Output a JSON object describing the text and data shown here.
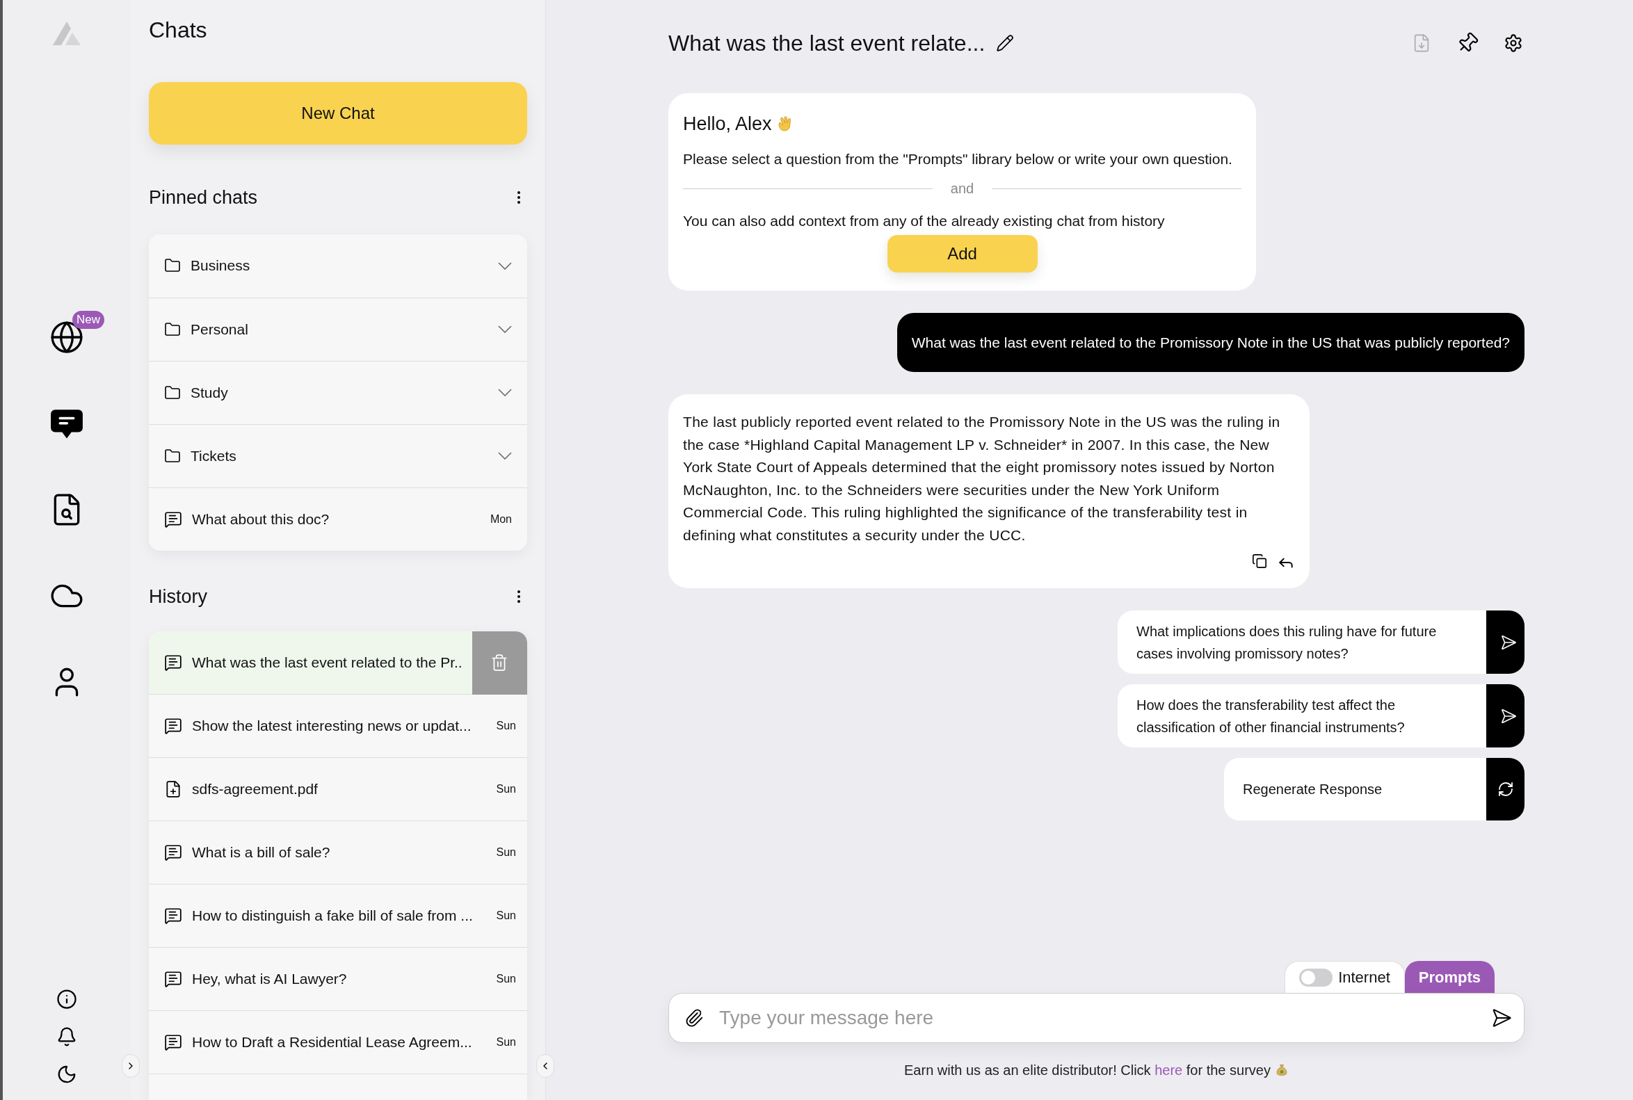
{
  "nav": {
    "items": [
      {
        "kind": "globe",
        "badge": "New",
        "selected": false
      },
      {
        "kind": "chat",
        "selected": true
      },
      {
        "kind": "doc",
        "selected": false
      },
      {
        "kind": "cloud",
        "selected": false
      },
      {
        "kind": "user",
        "selected": false
      }
    ]
  },
  "sidebar": {
    "title": "Chats",
    "new_chat": "New Chat",
    "pinned": {
      "title": "Pinned chats",
      "items": [
        {
          "kind": "folder",
          "label": "Business"
        },
        {
          "kind": "folder",
          "label": "Personal"
        },
        {
          "kind": "folder",
          "label": "Study"
        },
        {
          "kind": "folder",
          "label": "Tickets"
        },
        {
          "kind": "chat",
          "label": "What about this doc?",
          "date": "Mon"
        }
      ]
    },
    "history": {
      "title": "History",
      "items": [
        {
          "kind": "chat",
          "label": "What was the last event related to the Pr..",
          "selected": true
        },
        {
          "kind": "chat",
          "label": "Show the latest interesting news or updat...",
          "date": "Sun",
          "selected": false
        },
        {
          "kind": "file",
          "label": "sdfs-agreement.pdf",
          "date": "Sun",
          "selected": false
        },
        {
          "kind": "chat",
          "label": "What is a bill of sale?",
          "date": "Sun",
          "selected": false
        },
        {
          "kind": "chat",
          "label": "How to distinguish a fake bill of sale from ...",
          "date": "Sun",
          "selected": false
        },
        {
          "kind": "chat",
          "label": "Hey, what is AI Lawyer?",
          "date": "Sun",
          "selected": false
        },
        {
          "kind": "chat",
          "label": "How to Draft a Residential Lease Agreem...",
          "date": "Sun",
          "selected": false
        }
      ]
    }
  },
  "chat": {
    "title": "What was the last event relate...",
    "greeting": {
      "title": "Hello, Alex",
      "text": "Please select a question from the \"Prompts\" library below or write your own question.",
      "divider": "and",
      "context_text": "You can also add context from any of the already existing chat from history",
      "add_button": "Add"
    },
    "messages": [
      {
        "kind": "user",
        "text": "What was the last event related to the Promissory Note in the US that was publicly reported?"
      },
      {
        "kind": "assistant",
        "text": "The last publicly reported event related to the Promissory Note in the US was the ruling in the case *Highland Capital Management LP v. Schneider* in 2007. In this case, the New York State Court of Appeals determined that the eight promissory notes issued by Norton McNaughton, Inc. to the Schneiders were securities under the New York Uniform Commercial Code. This ruling highlighted the significance of the transferability test in defining what constitutes a security under the UCC."
      }
    ],
    "suggestions": [
      {
        "kind": "send",
        "text": "What implications does this ruling have for future cases involving promissory notes?"
      },
      {
        "kind": "send",
        "text": "How does the transferability test affect the classification of other financial instruments?"
      },
      {
        "kind": "regenerate",
        "text": "Regenerate Response"
      }
    ],
    "internet_toggle": {
      "label": "Internet",
      "on": false
    },
    "prompts_button": "Prompts",
    "input": {
      "placeholder": "Type your message here"
    },
    "footer": {
      "before": "Earn with us as an elite distributor! Click",
      "link": "here",
      "after": "for the survey"
    }
  }
}
